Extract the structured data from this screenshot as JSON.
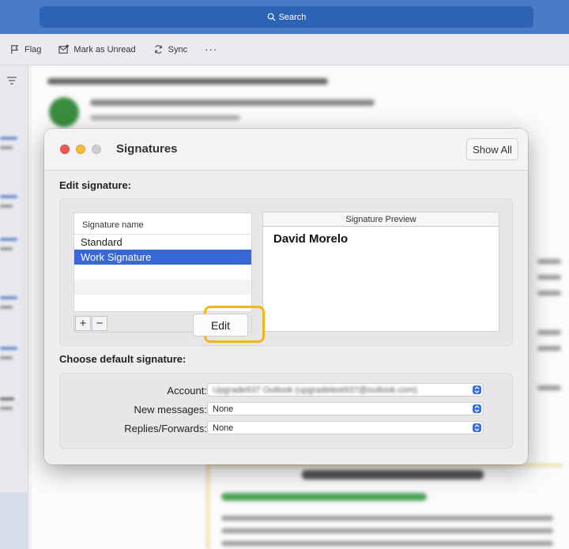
{
  "search": {
    "label": "Search"
  },
  "toolbar": {
    "flag": "Flag",
    "mark_unread": "Mark as Unread",
    "sync": "Sync",
    "more": "···"
  },
  "dialog": {
    "title": "Signatures",
    "show_all": "Show All",
    "edit_section": "Edit signature:",
    "list_header": "Signature name",
    "signatures": [
      {
        "name": "Standard",
        "selected": false
      },
      {
        "name": "Work Signature",
        "selected": true
      }
    ],
    "add_label": "+",
    "remove_label": "−",
    "edit_label": "Edit",
    "preview_header": "Signature Preview",
    "preview_name": "David Morelo",
    "default_section": "Choose default signature:",
    "account_label": "Account:",
    "account_value": "Upgrade937 Outlook (upgradetest937@outlook.com)",
    "new_messages_label": "New messages:",
    "new_messages_value": "None",
    "replies_label": "Replies/Forwards:",
    "replies_value": "None"
  },
  "colors": {
    "accent": "#3867d6",
    "highlight": "#f2b51b",
    "topbar": "#4a7bc9"
  }
}
